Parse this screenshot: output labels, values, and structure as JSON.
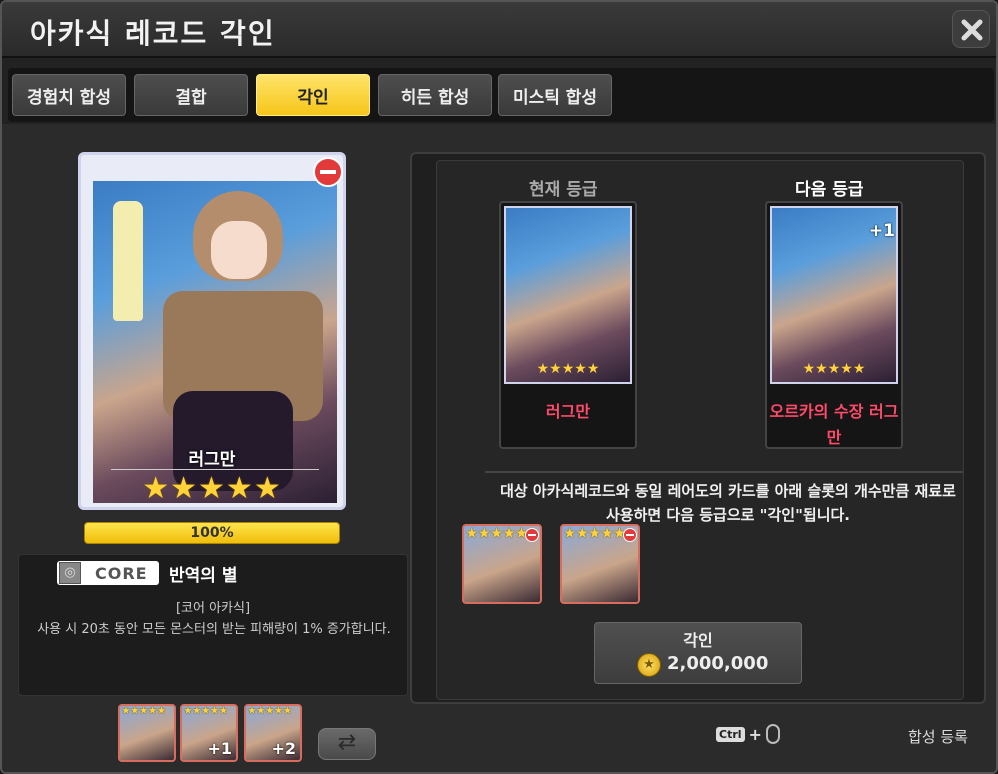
{
  "window": {
    "title": "아카식 레코드 각인"
  },
  "tabs": [
    {
      "label": "경험치 합성",
      "active": false
    },
    {
      "label": "결합",
      "active": false
    },
    {
      "label": "각인",
      "active": true
    },
    {
      "label": "히든 합성",
      "active": false
    },
    {
      "label": "미스틱 합성",
      "active": false
    }
  ],
  "main_card": {
    "name": "러그만",
    "stars": "★★★★★",
    "progress": "100%",
    "progress_value": 1.0
  },
  "core": {
    "badge": "CORE",
    "name": "반역의 별",
    "type": "[코어 아카식]",
    "description": "사용 시 20초 동안 모든 몬스터의 받는 피해량이 1% 증가합니다."
  },
  "bottom_slots": [
    {
      "stars": "★★★★★",
      "plus": ""
    },
    {
      "stars": "★★★★★",
      "plus": "+1"
    },
    {
      "stars": "★★★★★",
      "plus": "+2"
    }
  ],
  "current": {
    "label": "현재 등급",
    "name": "러그만",
    "stars": "★★★★★"
  },
  "next": {
    "label": "다음 등급",
    "name": "오르카의 수장 러그만",
    "stars": "★★★★★",
    "plus": "+1"
  },
  "instruction": "대상 아카식레코드와 동일 레어도의 카드를 아래 슬롯의 개수만큼 재료로 사용하면 다음 등급으로 \"각인\"됩니다.",
  "material_slots": [
    {
      "stars": "★★★★★"
    },
    {
      "stars": "★★★★★"
    }
  ],
  "engrave": {
    "label": "각인",
    "cost": "2,000,000"
  },
  "hint": {
    "ctrl": "Ctrl",
    "plus": "+"
  },
  "synth_register": "합성 등록",
  "colors": {
    "accent": "#f5c518",
    "next_name": "#ff4a6a",
    "star": "#ffd23a"
  }
}
